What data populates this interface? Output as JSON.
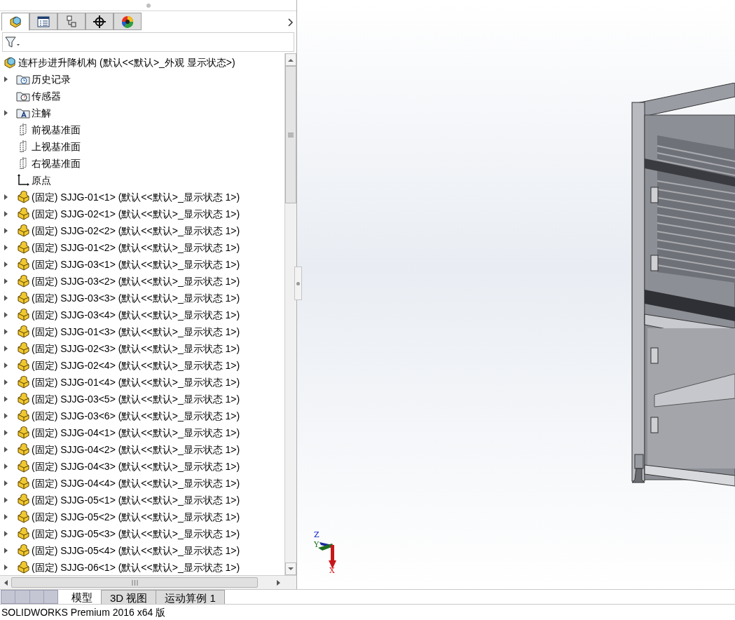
{
  "panel_tabs": [
    {
      "kind": "feature-tree",
      "selected": true
    },
    {
      "kind": "property",
      "selected": false
    },
    {
      "kind": "configuration",
      "selected": false
    },
    {
      "kind": "dimxpert",
      "selected": false
    },
    {
      "kind": "display",
      "selected": false
    }
  ],
  "tree": {
    "root": {
      "label": "连杆步进升降机构  (默认<<默认>_外观 显示状态>)"
    },
    "items": [
      {
        "kind": "history",
        "label": "历史记录",
        "expandable": true
      },
      {
        "kind": "sensor",
        "label": "传感器",
        "expandable": false
      },
      {
        "kind": "annotation",
        "label": "注解",
        "expandable": true
      },
      {
        "kind": "plane",
        "label": "前视基准面",
        "expandable": false
      },
      {
        "kind": "plane",
        "label": "上视基准面",
        "expandable": false
      },
      {
        "kind": "plane",
        "label": "右视基准面",
        "expandable": false
      },
      {
        "kind": "origin",
        "label": "原点",
        "expandable": false
      },
      {
        "kind": "part",
        "label": "(固定) SJJG-01<1> (默认<<默认>_显示状态 1>)",
        "expandable": true
      },
      {
        "kind": "part",
        "label": "(固定) SJJG-02<1> (默认<<默认>_显示状态 1>)",
        "expandable": true
      },
      {
        "kind": "part",
        "label": "(固定) SJJG-02<2> (默认<<默认>_显示状态 1>)",
        "expandable": true
      },
      {
        "kind": "part",
        "label": "(固定) SJJG-01<2> (默认<<默认>_显示状态 1>)",
        "expandable": true
      },
      {
        "kind": "part",
        "label": "(固定) SJJG-03<1> (默认<<默认>_显示状态 1>)",
        "expandable": true
      },
      {
        "kind": "part",
        "label": "(固定) SJJG-03<2> (默认<<默认>_显示状态 1>)",
        "expandable": true
      },
      {
        "kind": "part",
        "label": "(固定) SJJG-03<3> (默认<<默认>_显示状态 1>)",
        "expandable": true
      },
      {
        "kind": "part",
        "label": "(固定) SJJG-03<4> (默认<<默认>_显示状态 1>)",
        "expandable": true
      },
      {
        "kind": "part",
        "label": "(固定) SJJG-01<3> (默认<<默认>_显示状态 1>)",
        "expandable": true
      },
      {
        "kind": "part",
        "label": "(固定) SJJG-02<3> (默认<<默认>_显示状态 1>)",
        "expandable": true
      },
      {
        "kind": "part",
        "label": "(固定) SJJG-02<4> (默认<<默认>_显示状态 1>)",
        "expandable": true
      },
      {
        "kind": "part",
        "label": "(固定) SJJG-01<4> (默认<<默认>_显示状态 1>)",
        "expandable": true
      },
      {
        "kind": "part",
        "label": "(固定) SJJG-03<5> (默认<<默认>_显示状态 1>)",
        "expandable": true
      },
      {
        "kind": "part",
        "label": "(固定) SJJG-03<6> (默认<<默认>_显示状态 1>)",
        "expandable": true
      },
      {
        "kind": "part",
        "label": "(固定) SJJG-04<1> (默认<<默认>_显示状态 1>)",
        "expandable": true
      },
      {
        "kind": "part",
        "label": "(固定) SJJG-04<2> (默认<<默认>_显示状态 1>)",
        "expandable": true
      },
      {
        "kind": "part",
        "label": "(固定) SJJG-04<3> (默认<<默认>_显示状态 1>)",
        "expandable": true
      },
      {
        "kind": "part",
        "label": "(固定) SJJG-04<4> (默认<<默认>_显示状态 1>)",
        "expandable": true
      },
      {
        "kind": "part",
        "label": "(固定) SJJG-05<1> (默认<<默认>_显示状态 1>)",
        "expandable": true
      },
      {
        "kind": "part",
        "label": "(固定) SJJG-05<2> (默认<<默认>_显示状态 1>)",
        "expandable": true
      },
      {
        "kind": "part",
        "label": "(固定) SJJG-05<3> (默认<<默认>_显示状态 1>)",
        "expandable": true
      },
      {
        "kind": "part",
        "label": "(固定) SJJG-05<4> (默认<<默认>_显示状态 1>)",
        "expandable": true
      },
      {
        "kind": "part",
        "label": "(固定) SJJG-06<1> (默认<<默认>_显示状态 1>)",
        "expandable": true
      }
    ]
  },
  "bottom_tabs": [
    {
      "label": "模型",
      "selected": true
    },
    {
      "label": "3D 视图",
      "selected": false
    },
    {
      "label": "运动算例 1",
      "selected": false
    }
  ],
  "viewport": {
    "triad": {
      "z": "Z",
      "y": "Y",
      "x": "X"
    }
  },
  "status_bar": {
    "text": "SOLIDWORKS Premium 2016 x64 版"
  }
}
